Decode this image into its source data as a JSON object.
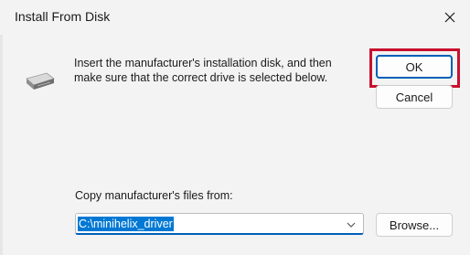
{
  "window": {
    "title": "Install From Disk"
  },
  "message": {
    "instructions": "Insert the manufacturer's installation disk, and then make sure that the correct drive is selected below."
  },
  "buttons": {
    "ok_label": "OK",
    "cancel_label": "Cancel",
    "browse_label": "Browse..."
  },
  "copy_from": {
    "label": "Copy manufacturer's files from:",
    "path_value": "C:\\minihelix_driver"
  },
  "icons": {
    "close": "close-icon",
    "disk": "disk-drive-icon",
    "dropdown": "chevron-down-icon"
  },
  "colors": {
    "accent": "#005fb8",
    "highlight": "#c8102e",
    "selection": "#0078d4",
    "background": "#f3f3f3"
  }
}
